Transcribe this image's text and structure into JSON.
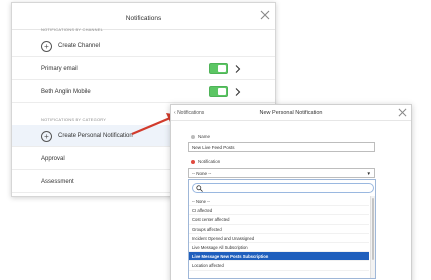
{
  "colors": {
    "accent": "#1f5fbd",
    "toggle_on": "#5cc664",
    "arrow": "#d23b2c",
    "required": "#e04a3f"
  },
  "notifications_panel": {
    "title": "Notifications",
    "close_icon": "close-icon",
    "cut_section_label": "NOTIFICATIONS BY CHANNEL",
    "create_channel_label": "Create Channel",
    "channels": [
      {
        "label": "Primary email",
        "enabled": true
      },
      {
        "label": "Beth Anglin Mobile",
        "enabled": true
      }
    ],
    "category_section_label": "NOTIFICATIONS BY CATEGORY",
    "create_personal_label": "Create Personal Notification",
    "categories": [
      "Approval",
      "Assessment"
    ]
  },
  "new_notification_panel": {
    "back_label": "Notifications",
    "title": "New Personal Notification",
    "name_label": "Name",
    "name_value": "New Live Feed Posts",
    "notification_label": "Notification",
    "notification_value": "-- None --",
    "search_value": "",
    "options": [
      "-- None --",
      "CI affected",
      "Cost center affected",
      "Groups affected",
      "Incident Opened and Unassigned",
      "Live Message All Subscription",
      "Live Message New Posts Subscription",
      "Location affected"
    ],
    "selected_option": "Live Message New Posts Subscription"
  }
}
